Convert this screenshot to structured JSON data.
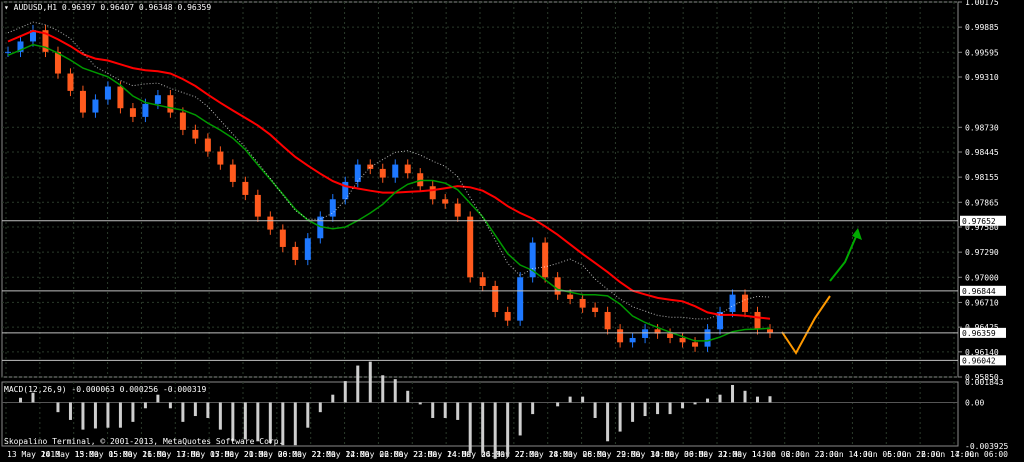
{
  "header": {
    "symbol": "AUDUSD,H1",
    "ohlc": "0.96397 0.96407 0.96348 0.96359"
  },
  "indicator": {
    "label": "MACD(12,26,9) -0.000063 0.000256 -0.000319"
  },
  "footer": {
    "copyright": "Skopalino Terminal, © 2001-2013, MetaQuotes Software Corp."
  },
  "colors": {
    "background": "#000000",
    "grid": "#2a3a2a",
    "bull": "#1e78ff",
    "bear": "#ff5a1e",
    "ma_red": "#ff0000",
    "ma_green": "#009a00",
    "cloud": "#ffffff",
    "projection_orange": "#ff9900",
    "projection_green": "#00aa00"
  },
  "chart_data": [
    {
      "type": "candlestick",
      "title": "AUDUSD,H1",
      "ylim": [
        0.9585,
        1.00175
      ],
      "price_scale_ticks": [
        "1.00175",
        "0.99885",
        "0.99595",
        "0.99310",
        "0.98730",
        "0.98445",
        "0.98155",
        "0.97865",
        "0.97580",
        "0.97290",
        "0.97000",
        "0.96710",
        "0.96425",
        "0.96140",
        "0.95850"
      ],
      "time_ticks": [
        "13 May 2013",
        "14 May 13:00",
        "15 May 05:00",
        "15 May 21:00",
        "16 May 13:00",
        "17 May 05:00",
        "17 May 21:00",
        "20 May 06:00",
        "20 May 22:00",
        "21 May 14:00",
        "22 May 06:00",
        "22 May 22:00",
        "23 May 14:00",
        "24 May 06:00",
        "24 May 22:00",
        "27 May 14:00",
        "28 May 06:00",
        "28 May 22:00",
        "29 May 14:00",
        "30 May 06:00",
        "30 May 22:00",
        "31 May 14:00",
        "1 Jun 06:00",
        "2 Jun 22:00",
        "3 Jun 14:00",
        "4 Jun 06:00",
        "5 Jun 22:00",
        "6 Jun 14:00",
        "7 Jun 06:00"
      ],
      "price_labels": [
        {
          "label": "0.97652",
          "value": 0.97652
        },
        {
          "label": "0.96844",
          "value": 0.96844
        },
        {
          "label": "0.96359",
          "value": 0.96359
        },
        {
          "label": "0.96042",
          "value": 0.96042
        }
      ],
      "close_series_approx": [
        0.996,
        0.9972,
        0.9985,
        0.996,
        0.9935,
        0.9915,
        0.989,
        0.9905,
        0.992,
        0.9895,
        0.9885,
        0.99,
        0.991,
        0.989,
        0.987,
        0.986,
        0.9845,
        0.983,
        0.981,
        0.9795,
        0.977,
        0.9755,
        0.9735,
        0.972,
        0.9745,
        0.977,
        0.979,
        0.981,
        0.983,
        0.9825,
        0.9815,
        0.983,
        0.982,
        0.9805,
        0.979,
        0.9785,
        0.977,
        0.97,
        0.969,
        0.966,
        0.965,
        0.97,
        0.974,
        0.97,
        0.968,
        0.9675,
        0.9665,
        0.966,
        0.964,
        0.9625,
        0.963,
        0.964,
        0.9635,
        0.963,
        0.9625,
        0.962,
        0.964,
        0.966,
        0.968,
        0.966,
        0.964,
        0.9636
      ]
    },
    {
      "type": "histogram",
      "title": "MACD(12,26,9)",
      "ylim": [
        -0.003925,
        0.001843
      ],
      "scale_ticks": [
        "0.001843",
        "0.00",
        "-0.003925"
      ]
    }
  ]
}
